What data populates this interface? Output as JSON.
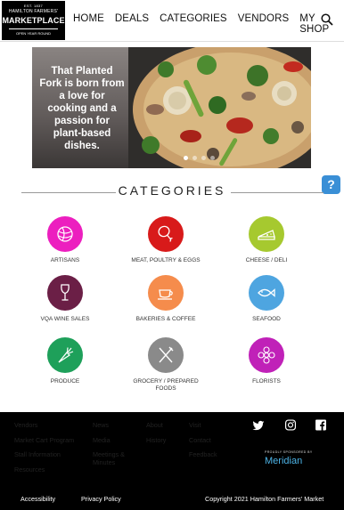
{
  "logo": {
    "est": "EST. 1837",
    "name": "HAMILTON FARMERS'",
    "market": "MARKET",
    "place": "PLACE",
    "tagline": "OPEN YEAR ROUND"
  },
  "nav": [
    {
      "label": "HOME"
    },
    {
      "label": "DEALS"
    },
    {
      "label": "CATEGORIES"
    },
    {
      "label": "VENDORS"
    },
    {
      "label": "MY SHOP"
    }
  ],
  "hero": {
    "text": "That Planted Fork is born from a love for cooking and a passion for plant-based dishes."
  },
  "help": {
    "label": "?"
  },
  "categories": {
    "heading": "CATEGORIES",
    "items": [
      {
        "label": "ARTISANS",
        "color": "#ec1fbf"
      },
      {
        "label": "MEAT, POULTRY & EGGS",
        "color": "#d81a1a"
      },
      {
        "label": "CHEESE / DELI",
        "color": "#a6c92f"
      },
      {
        "label": "VQA WINE SALES",
        "color": "#6b1f46"
      },
      {
        "label": "BAKERIES & COFFEE",
        "color": "#f58c4c"
      },
      {
        "label": "SEAFOOD",
        "color": "#4ea5e0"
      },
      {
        "label": "PRODUCE",
        "color": "#1ea05a"
      },
      {
        "label": "GROCERY / PREPARED FOODS",
        "color": "#8a8a8a"
      },
      {
        "label": "FLORISTS",
        "color": "#c021b8"
      }
    ]
  },
  "footer": {
    "col1": [
      "Vendors",
      "Market Cart Program",
      "Stall Information",
      "Resources"
    ],
    "col2": [
      "News",
      "Media",
      "Meetings & Minutes"
    ],
    "col3": [
      "About",
      "History"
    ],
    "col4": [
      "Visit",
      "Contact",
      "Feedback"
    ],
    "sponsor_pre": "PROUDLY SPONSORED BY",
    "sponsor_name": "Meridian",
    "accessibility": "Accessibility",
    "privacy": "Privacy Policy",
    "copyright": "Copyright 2021 Hamilton Farmers' Market"
  }
}
